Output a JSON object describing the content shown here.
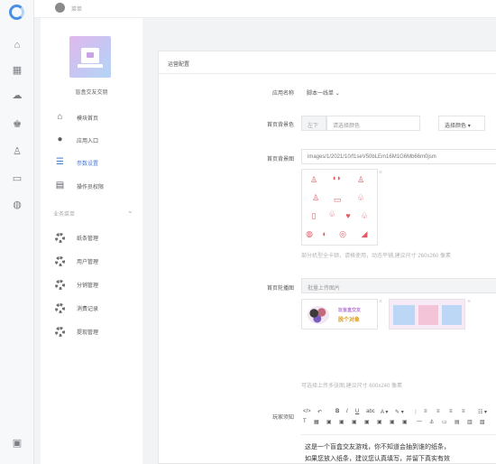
{
  "topbar": {
    "breadcrumb": "菜单"
  },
  "rail": {
    "icons": [
      "home-icon",
      "apps-icon",
      "cloud-icon",
      "users-icon",
      "user-icon",
      "monitor-icon",
      "globe-icon",
      "lock-icon"
    ]
  },
  "app": {
    "name": "盲盒交友交朋"
  },
  "menu": {
    "items": [
      {
        "label": "模块首页",
        "icon": "home-icon"
      },
      {
        "label": "应用入口",
        "icon": "chat-icon"
      },
      {
        "label": "参数设置",
        "icon": "list-icon"
      },
      {
        "label": "操作员权限",
        "icon": "document-icon"
      }
    ],
    "group_title": "业务菜单",
    "group_items": [
      {
        "label": "纸条管理"
      },
      {
        "label": "用户管理"
      },
      {
        "label": "分销管理"
      },
      {
        "label": "消费记录"
      },
      {
        "label": "提现管理"
      }
    ]
  },
  "panel": {
    "title": "运营配置",
    "app_name_label": "应用名称",
    "app_name_value": "脚本一线单",
    "bg_color_label": "首页背景色",
    "bg_color_prefix": "左下",
    "bg_color_placeholder": "请选择颜色",
    "bg_color_button": "选择颜色",
    "bg_image_label": "首页背景图",
    "bg_image_path": "images/1/2021/10/f1seV50bLEm16M1G6Mb66m0jsm",
    "bg_image_hint": "部分机型全卡顿，请格使用，动态平铺,建议尺寸 260x260 像素",
    "carousel_label": "首页轮播图",
    "carousel_button": "批量上传图片",
    "carousel_banner_text1": "玩盲盒交友",
    "carousel_banner_text2": "脱个对象",
    "carousel_hint": "可选择上传多张图,建议尺寸 600x240 像素",
    "notice_label": "玩家须知",
    "editor_line1": "这是一个盲盒交友游戏，你不知道会抽到谁的纸条，",
    "editor_line2": "如果您放入纸条，建议您认真填写，并留下真实有效"
  },
  "colors": {
    "accent": "#4a7bd8",
    "pattern": "#e25b63",
    "logo": "#4a90e2"
  }
}
